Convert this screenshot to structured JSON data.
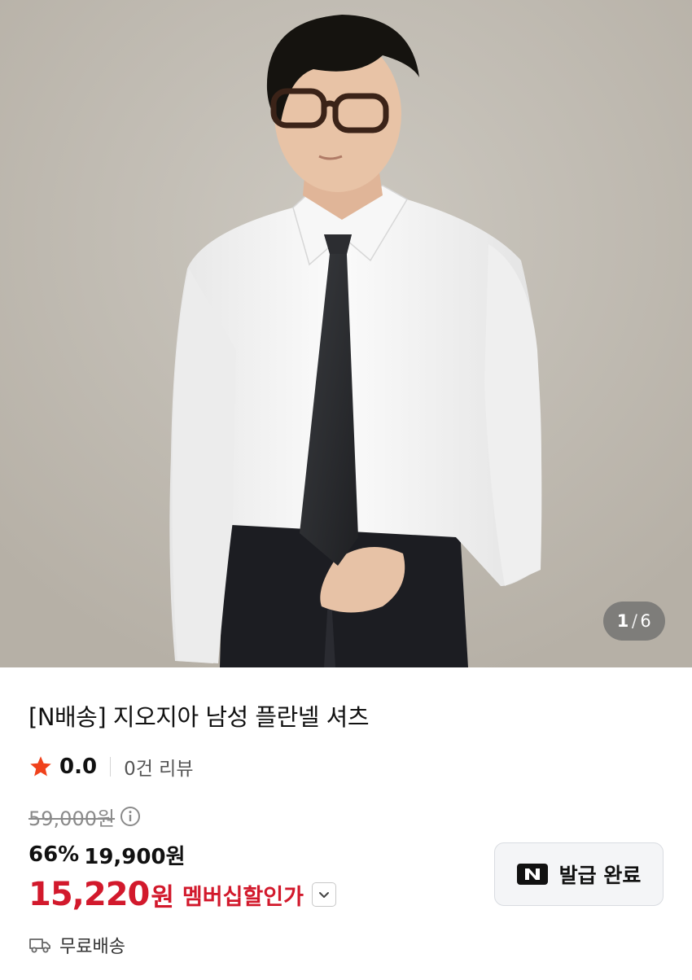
{
  "carousel": {
    "current": "1",
    "separator": "/",
    "total": "6"
  },
  "product": {
    "title": "[N배송] 지오지아 남성 플란넬 셔츠",
    "rating": "0.0",
    "review_count": "0건 리뷰",
    "original_price": "59,000원",
    "discount_rate": "66%",
    "sale_price": "19,900원",
    "member_price": "15,220",
    "member_price_unit": "원",
    "member_price_label": "멤버십할인가",
    "shipping": "무료배송"
  },
  "coupon": {
    "logo_letter": "N",
    "label": "발급 완료"
  },
  "icons": {
    "rating": "star-icon",
    "price_info": "info-icon",
    "expand": "chevron-down-icon",
    "shipping": "truck-icon"
  },
  "colors": {
    "accent_red": "#d2192c",
    "star": "#f0421c",
    "strike_gray": "#8a8a8a"
  }
}
